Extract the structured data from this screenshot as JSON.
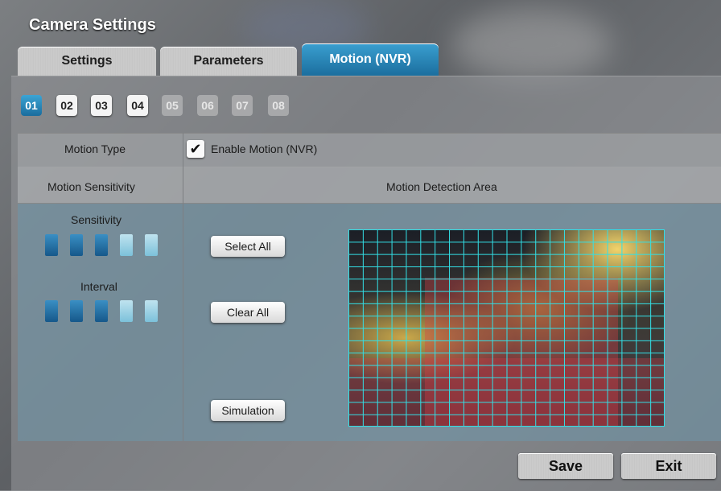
{
  "window": {
    "title": "Camera Settings"
  },
  "tabs": [
    {
      "label": "Settings",
      "active": false
    },
    {
      "label": "Parameters",
      "active": false
    },
    {
      "label": "Motion (NVR)",
      "active": true
    }
  ],
  "cameras": [
    {
      "label": "01",
      "state": "selected"
    },
    {
      "label": "02",
      "state": "available"
    },
    {
      "label": "03",
      "state": "available"
    },
    {
      "label": "04",
      "state": "available"
    },
    {
      "label": "05",
      "state": "disabled"
    },
    {
      "label": "06",
      "state": "disabled"
    },
    {
      "label": "07",
      "state": "disabled"
    },
    {
      "label": "08",
      "state": "disabled"
    }
  ],
  "motion_type": {
    "label": "Motion Type",
    "enable_label": "Enable Motion (NVR)",
    "enabled": true
  },
  "sensitivity_panel": {
    "header": "Motion Sensitivity",
    "sensitivity_label": "Sensitivity",
    "sensitivity_level": 3,
    "sensitivity_max": 5,
    "interval_label": "Interval",
    "interval_level": 3,
    "interval_max": 5
  },
  "detection_area": {
    "header": "Motion Detection Area",
    "select_all": "Select All",
    "clear_all": "Clear All",
    "simulation": "Simulation",
    "grid_columns": 22,
    "grid_rows": 16,
    "grid_color": "#33e0e6"
  },
  "footer": {
    "save": "Save",
    "exit": "Exit"
  },
  "colors": {
    "accent": "#1f7fb4",
    "panel": "#6e96aa"
  }
}
